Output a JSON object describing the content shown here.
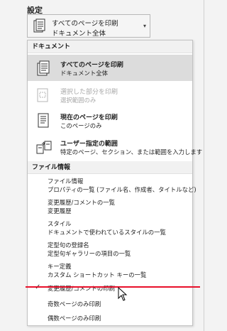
{
  "settings": {
    "title": "設定",
    "dropdown": {
      "line1": "すべてのページを印刷",
      "line2": "ドキュメント全体",
      "chevron_icon": "chevron-down-icon"
    }
  },
  "menu": {
    "document_header": "ドキュメント",
    "document_items": [
      {
        "title": "すべてのページを印刷",
        "subtitle": "ドキュメント全体",
        "icon": "document-pages-icon",
        "selected": true,
        "disabled": false
      },
      {
        "title": "選択した部分を印刷",
        "subtitle": "選択範囲のみ",
        "icon": "selection-icon",
        "selected": false,
        "disabled": true
      },
      {
        "title": "現在のページを印刷",
        "subtitle": "このページのみ",
        "icon": "current-page-icon",
        "selected": false,
        "disabled": false
      },
      {
        "title": "ユーザー指定の範囲",
        "subtitle": "特定のページ、セクション、または範囲を入力します",
        "icon": "custom-range-icon",
        "selected": false,
        "disabled": false
      }
    ],
    "file_info_header": "ファイル情報",
    "file_info_items": [
      {
        "title": "ファイル情報",
        "subtitle": "プロパティの一覧 (ファイル名、作成者、タイトルなど)"
      },
      {
        "title": "変更履歴/コメントの一覧",
        "subtitle": "変更履歴"
      },
      {
        "title": "スタイル",
        "subtitle": "ドキュメントで使われているスタイルの一覧"
      },
      {
        "title": "定型句の登録名",
        "subtitle": "定型句ギャラリーの項目の一覧"
      },
      {
        "title": "キー定義",
        "subtitle": "カスタム ショートカット キーの一覧"
      }
    ],
    "toggle_items": [
      {
        "label": "変更履歴/コメントの印刷",
        "checked": true
      },
      {
        "label": "奇数ページのみ印刷",
        "checked": false
      },
      {
        "label": "偶数ページのみ印刷",
        "checked": false
      }
    ],
    "check_glyph": "✓"
  },
  "colors": {
    "highlight_line": "#e8102a",
    "selected_bg": "#dcdcdc"
  }
}
